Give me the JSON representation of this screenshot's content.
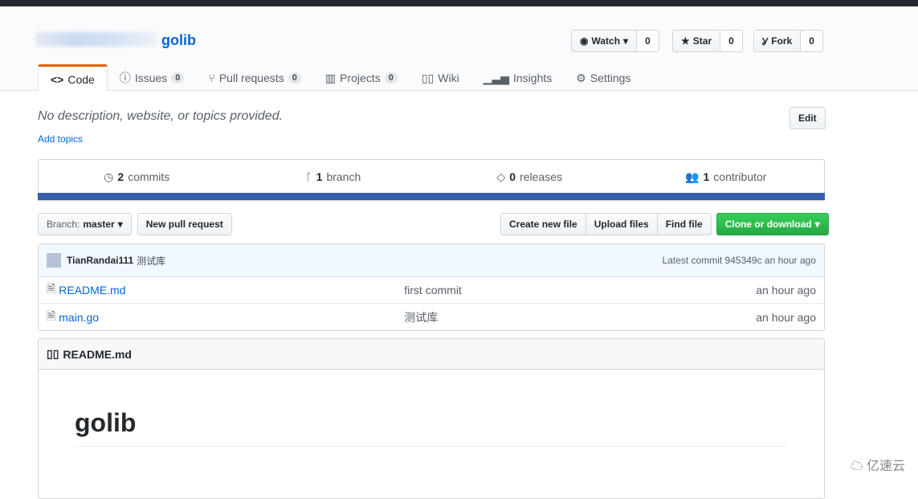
{
  "repo": {
    "name": "golib"
  },
  "actions": {
    "watch": "Watch",
    "watch_count": "0",
    "star": "Star",
    "star_count": "0",
    "fork": "Fork",
    "fork_count": "0"
  },
  "tabs": [
    {
      "label": "Code"
    },
    {
      "label": "Issues",
      "count": "0"
    },
    {
      "label": "Pull requests",
      "count": "0"
    },
    {
      "label": "Projects",
      "count": "0"
    },
    {
      "label": "Wiki"
    },
    {
      "label": "Insights"
    },
    {
      "label": "Settings"
    }
  ],
  "description": "No description, website, or topics provided.",
  "add_topics": "Add topics",
  "edit": "Edit",
  "summary": {
    "commits_n": "2",
    "commits": "commits",
    "branch_n": "1",
    "branch": "branch",
    "releases_n": "0",
    "releases": "releases",
    "contrib_n": "1",
    "contrib": "contributor"
  },
  "branch": {
    "label": "Branch:",
    "value": "master"
  },
  "new_pr": "New pull request",
  "file_actions": {
    "create": "Create new file",
    "upload": "Upload files",
    "find": "Find file",
    "clone": "Clone or download"
  },
  "commit": {
    "author": "TianRandai111",
    "message": "测试库",
    "latest": "Latest commit 945349c an hour ago"
  },
  "files": [
    {
      "name": "README.md",
      "message": "first commit",
      "age": "an hour ago"
    },
    {
      "name": "main.go",
      "message": "测试库",
      "age": "an hour ago"
    }
  ],
  "readme": {
    "header": "README.md",
    "title": "golib"
  },
  "watermark": "亿速云",
  "colors": {
    "accent": "#0366d6",
    "tab_active": "#e36209",
    "lang_bar": "#375eab",
    "clone": "#28a745"
  }
}
